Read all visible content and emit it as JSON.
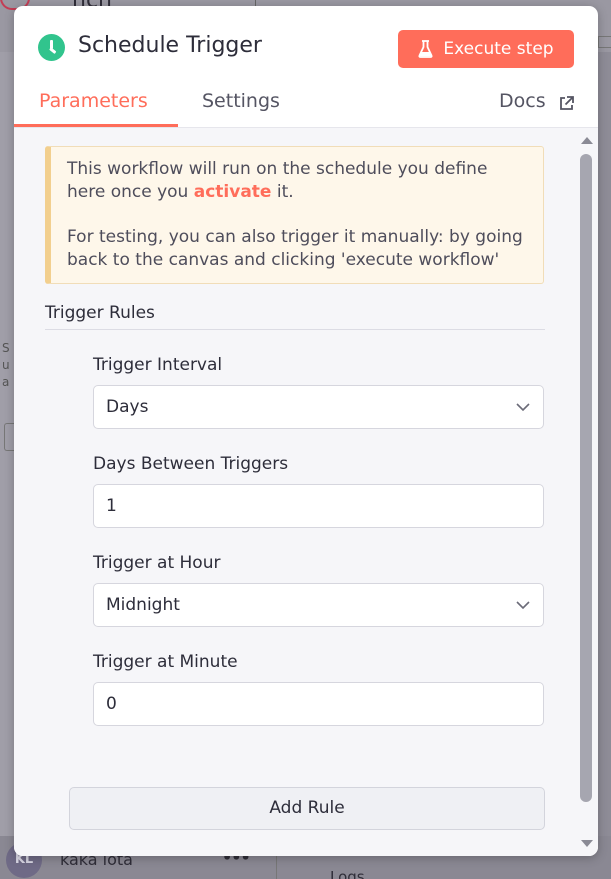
{
  "background": {
    "app_title_fragment": "ncn",
    "left_snippet": [
      "S",
      "u",
      "a"
    ],
    "user_initials": "KL",
    "user_name": "kaka lota",
    "user_menu": "•••",
    "right_fragment": "Logs"
  },
  "modal": {
    "node_icon": "clock-icon",
    "title": "Schedule Trigger",
    "execute_button": {
      "label": "Execute step",
      "icon": "flask-icon"
    },
    "tabs": [
      {
        "label": "Parameters",
        "active": true
      },
      {
        "label": "Settings",
        "active": false
      }
    ],
    "docs": {
      "label": "Docs",
      "icon": "external-link-icon"
    },
    "notice": {
      "line1_before": "This workflow will run on the schedule you define here once you ",
      "line1_link": "activate",
      "line1_after": " it.",
      "line2": "For testing, you can also trigger it manually: by going back to the canvas and clicking 'execute workflow'"
    },
    "section_title": "Trigger Rules",
    "fields": {
      "trigger_interval": {
        "label": "Trigger Interval",
        "value": "Days"
      },
      "days_between": {
        "label": "Days Between Triggers",
        "value": "1"
      },
      "trigger_hour": {
        "label": "Trigger at Hour",
        "value": "Midnight"
      },
      "trigger_minute": {
        "label": "Trigger at Minute",
        "value": "0"
      }
    },
    "add_rule_label": "Add Rule"
  },
  "colors": {
    "accent": "#ff6d5a",
    "node_icon": "#31c48d",
    "notice_bg": "#fef7ea",
    "notice_border": "#f2cf8e"
  }
}
